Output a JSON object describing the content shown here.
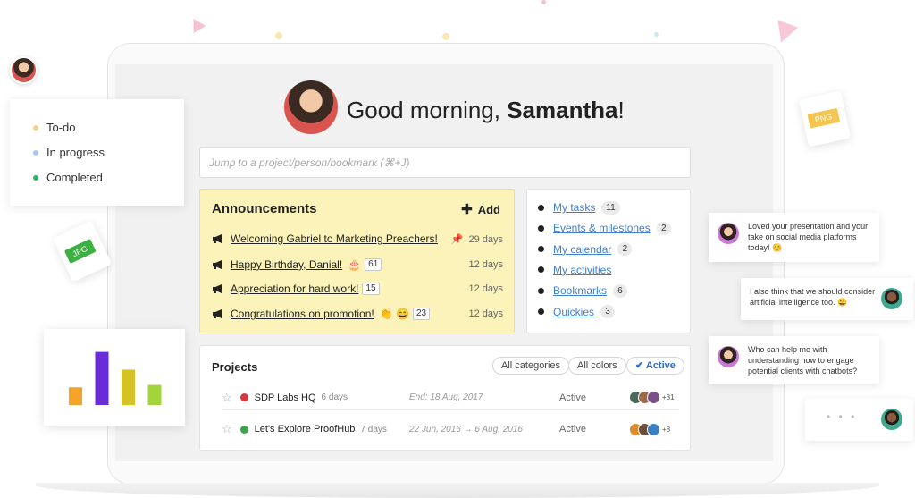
{
  "greeting": {
    "prefix": "Good morning, ",
    "name": "Samantha",
    "suffix": "!"
  },
  "search": {
    "placeholder": "Jump to a project/person/bookmark (⌘+J)"
  },
  "announcements": {
    "title": "Announcements",
    "add_label": "Add",
    "items": [
      {
        "text": "Welcoming Gabriel to Marketing Preachers!",
        "emoji": "",
        "count": "",
        "pinned": true,
        "time": "29 days"
      },
      {
        "text": "Happy Birthday, Danial!",
        "emoji": "🎂",
        "count": "61",
        "pinned": false,
        "time": "12 days"
      },
      {
        "text": "Appreciation for hard work!",
        "emoji": "",
        "count": "15",
        "pinned": false,
        "time": "12 days"
      },
      {
        "text": "Congratulations on promotion!",
        "emoji": "👏 😄",
        "count": "23",
        "pinned": false,
        "time": "12 days"
      }
    ]
  },
  "quick_links": [
    {
      "label": "My tasks",
      "count": "11"
    },
    {
      "label": "Events & milestones",
      "count": "2"
    },
    {
      "label": "My calendar",
      "count": "2"
    },
    {
      "label": "My activities",
      "count": ""
    },
    {
      "label": "Bookmarks",
      "count": "6"
    },
    {
      "label": "Quickies",
      "count": "3"
    }
  ],
  "projects": {
    "title": "Projects",
    "filters": [
      "All categories",
      "All colors",
      "Active"
    ],
    "active_filter_icon": "check-icon",
    "rows": [
      {
        "name": "SDP Labs HQ",
        "days": "6 days",
        "dates": "End: 18 Aug, 2017",
        "status": "Active",
        "color": "#d9363e",
        "more": "+31"
      },
      {
        "name": "Let's Explore ProofHub",
        "days": "7 days",
        "dates": "22 Jun, 2016 → 6 Aug, 2016",
        "status": "Active",
        "color": "#3aa54a",
        "more": "+8"
      }
    ]
  },
  "legend": [
    {
      "label": "To-do",
      "color": "#f2d48a"
    },
    {
      "label": "In progress",
      "color": "#a8c8f0"
    },
    {
      "label": "Completed",
      "color": "#2fb36a"
    }
  ],
  "files": {
    "jpg": "JPG",
    "png": "PNG"
  },
  "chart_data": {
    "type": "bar",
    "categories": [
      "",
      "",
      "",
      ""
    ],
    "values": [
      3,
      9,
      6,
      3.4
    ],
    "colors": [
      "#f6a32a",
      "#6a2bd9",
      "#d7c225",
      "#a4d43c"
    ],
    "ylim": [
      0,
      10
    ],
    "title": "",
    "xlabel": "",
    "ylabel": "",
    "grid": false
  },
  "chats": [
    {
      "text": "Loved your presentation and your take on social media platforms today! 😊",
      "avatar": "woman",
      "side": "left"
    },
    {
      "text": "I also think that we should consider artificial intelligence too. 😀",
      "avatar": "man",
      "side": "right"
    },
    {
      "text": "Who can help me with understanding how to engage potential clients with chatbots?",
      "avatar": "woman",
      "side": "left"
    },
    {
      "text": "• • •",
      "avatar": "man",
      "side": "right"
    }
  ],
  "colors": {
    "announcement_bg": "#fbf3b9",
    "link": "#3d7fd0",
    "accent_blue": "#2d6fd1"
  }
}
